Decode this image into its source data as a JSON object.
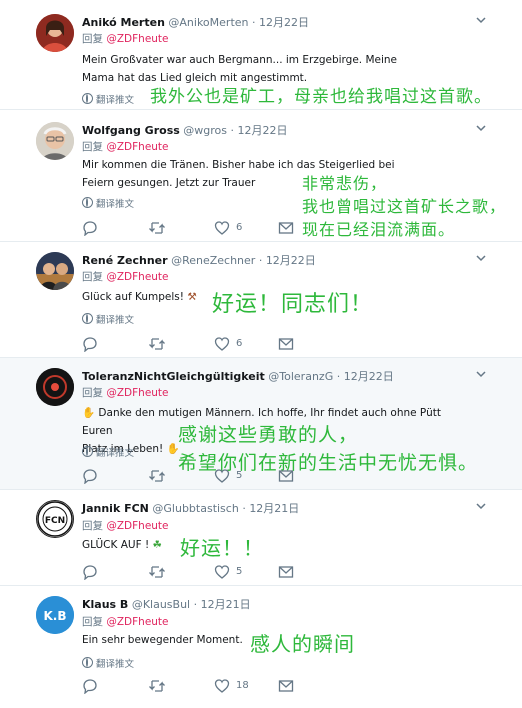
{
  "tweets": [
    {
      "name": "Anikó Merten",
      "handle": "@AnikoMerten",
      "date": "12月22日",
      "reply_prefix": "回复",
      "reply_to": "@ZDFheute",
      "text": "Mein Großvater war auch Bergmann... im Erzgebirge. Meine Mama hat das Lied gleich mit angestimmt.",
      "translate": "翻译推文",
      "annotation": "我外公也是矿工，母亲也给我唱过这首歌。",
      "avatar_color": "#b03a2e"
    },
    {
      "name": "Wolfgang Gross",
      "handle": "@wgros",
      "date": "12月22日",
      "reply_prefix": "回复",
      "reply_to": "@ZDFheute",
      "text": "Mir kommen die Tränen. Bisher habe ich das Steigerlied bei Feiern gesungen. Jetzt zur Trauer",
      "translate": "翻译推文",
      "annotation_lines": [
        "非常悲伤，",
        "我也曾唱过这首矿长之歌，",
        "现在已经泪流满面。"
      ],
      "likes": "6",
      "avatar_color": "#c9c2b6"
    },
    {
      "name": "René Zechner",
      "handle": "@ReneZechner",
      "date": "12月22日",
      "reply_prefix": "回复",
      "reply_to": "@ZDFheute",
      "text": "Glück auf Kumpels!",
      "emoji": "⚒",
      "translate": "翻译推文",
      "annotation": "好运！同志们！",
      "likes": "6",
      "avatar_color": "#3b4a6b"
    },
    {
      "name": "ToleranzNichtGleichgültigkeit",
      "handle": "@ToleranzG",
      "date": "12月22日",
      "reply_prefix": "回复",
      "reply_to": "@ZDFheute",
      "text_line1": "Danke den mutigen Männern. Ich hoffe, Ihr findet auch ohne Pütt Euren",
      "text_line2": "Platz im Leben!",
      "translate": "翻译推文",
      "annotation_lines": [
        "感谢这些勇敢的人，",
        "希望你们在新的生活中无忧无惧。"
      ],
      "likes": "5",
      "avatar_color": "#1c1c1c"
    },
    {
      "name": "Jannik FCN",
      "handle": "@Glubbtastisch",
      "date": "12月21日",
      "reply_prefix": "回复",
      "reply_to": "@ZDFheute",
      "text": "GLÜCK AUF !",
      "emoji": "☘",
      "annotation": "好运！！",
      "likes": "5",
      "avatar_text": "1.FCN"
    },
    {
      "name": "Klaus B",
      "handle": "@KlausBul",
      "date": "12月21日",
      "reply_prefix": "回复",
      "reply_to": "@ZDFheute",
      "text": "Ein sehr bewegender Moment.",
      "translate": "翻译推文",
      "annotation": "感人的瞬间",
      "likes": "18",
      "avatar_text": "K.B",
      "avatar_color": "#2a8fd6"
    }
  ],
  "colors": {
    "annotation": "#2eb83b",
    "mention": "#e0245e",
    "muted": "#657786",
    "shaded": "#f5f8fa"
  }
}
